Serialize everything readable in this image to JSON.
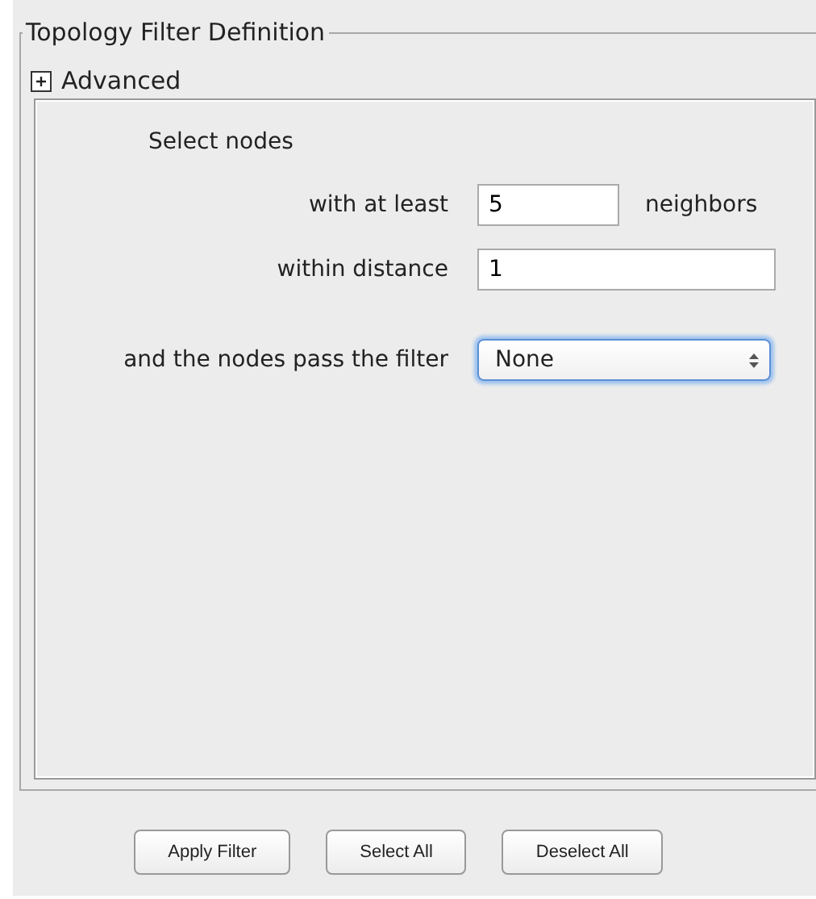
{
  "group": {
    "title": "Topology Filter Definition"
  },
  "advanced": {
    "label": "Advanced",
    "expanded": false
  },
  "heading": "Select nodes",
  "rows": [
    {
      "kind": "text",
      "label": "with at least",
      "value": "5",
      "suffix": "neighbors"
    },
    {
      "kind": "text",
      "label": "within distance",
      "value": "1"
    },
    {
      "kind": "select",
      "label": "and the nodes pass the filter",
      "value": "None",
      "focused": true
    }
  ],
  "buttons": [
    "Apply Filter",
    "Select All",
    "Deselect All"
  ]
}
